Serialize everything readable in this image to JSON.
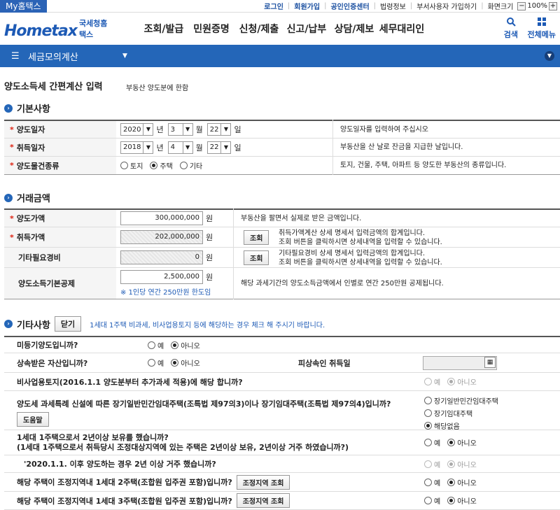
{
  "topbar": {
    "my_tag": "My홈택스",
    "links": [
      "로그인",
      "회원가입",
      "공인인증센터",
      "법령정보",
      "부서사용자 가입하기",
      "화면크기"
    ],
    "zoom_minus": "−",
    "zoom_value": "100%",
    "zoom_plus": "+"
  },
  "header": {
    "logo_tagline": "국세청 홈택스",
    "logo_text": "Hometax",
    "logo_sub": "국세청홈택스",
    "nav": [
      "조회/발급",
      "민원증명",
      "신청/제출",
      "신고/납부",
      "상담/제보",
      "세무대리인"
    ],
    "search_label": "검색",
    "menu_label": "전체메뉴"
  },
  "bluebar": {
    "title": "세금모의계산"
  },
  "page": {
    "title": "양도소득세 간편계산 입력",
    "subtitle": "부동산 양도분에 한함"
  },
  "basic": {
    "section_title": "기본사항",
    "transfer_date": {
      "label": "양도일자",
      "year": "2020",
      "month": "3",
      "day": "22",
      "desc": "양도일자를 입력하여 주십시오"
    },
    "acquire_date": {
      "label": "취득일자",
      "year": "2018",
      "month": "4",
      "day": "22",
      "desc": "부동산을 산 날로 잔금을 지급한 날입니다."
    },
    "type": {
      "label": "양도물건종류",
      "options": [
        "토지",
        "주택",
        "기타"
      ],
      "selected": "주택",
      "desc": "토지, 건물, 주택, 아파트 등 양도한 부동산의 종류입니다."
    },
    "unit_year": "년",
    "unit_month": "월",
    "unit_day": "일"
  },
  "amounts": {
    "section_title": "거래금액",
    "unit": "원",
    "transfer_price": {
      "label": "양도가액",
      "value": "300,000,000",
      "desc": "부동산을 팔면서 실제로 받은 금액입니다."
    },
    "acquire_price": {
      "label": "취득가액",
      "value": "202,000,000",
      "button": "조회",
      "desc1": "취득가액계산 상세 명세서 입력금액의 합계입니다.",
      "desc2": "조회 버튼을 클릭하시면 상세내역을 입력할 수 있습니다."
    },
    "other_expense": {
      "label": "기타필요경비",
      "value": "0",
      "button": "조회",
      "desc1": "기타필요경비 상세 명세서 입력금액의 합계입니다.",
      "desc2": "조회 버튼을 클릭하시면 상세내역을 입력할 수 있습니다."
    },
    "basic_deduction": {
      "label": "양도소득기본공제",
      "value": "2,500,000",
      "note": "※ 1인당 연간 250만원 한도임",
      "desc": "해당 과세기간의 양도소득금액에서 인별로 연간 250만원 공제됩니다."
    }
  },
  "others": {
    "section_title": "기타사항",
    "close_button": "닫기",
    "note": "1세대 1주택 비과세, 비사업용토지 등에 해당하는 경우 체크 해 주시기 바랍니다.",
    "yes": "예",
    "no": "아니오",
    "q1": "미등기양도입니까?",
    "q2": "상속받은 자산입니까?",
    "q2_date_label": "피상속인 취득일",
    "q3": "비사업용토지(2016.1.1 양도분부터 추가과세 적용)에 해당 합니까?",
    "q4": "양도세 과세특례 신설에 따른 장기일반민간임대주택(조특법 제97의3)이나 장기임대주택(조특법 제97의4)입니까?",
    "q4_help": "도움말",
    "q4_options": [
      "장기일반민간임대주택",
      "장기임대주택",
      "해당없음"
    ],
    "q5_line1": "1세대 1주택으로서 2년이상 보유를 했습니까?",
    "q5_line2": "(1세대 1주택으로서 취득당시 조정대상지역에 있는 주택은 2년이상 보유, 2년이상 거주 하였습니까?)",
    "q6": "'2020.1.1. 이후 양도하는 경우 2년 이상 거주 했습니까?",
    "q7": "해당 주택이 조정지역내 1세대 2주택(조합원 입주권 포함)입니까?",
    "q8": "해당 주택이 조정지역내 1세대 3주택(조합원 입주권 포함)입니까?",
    "region_button": "조정지역 조회"
  }
}
